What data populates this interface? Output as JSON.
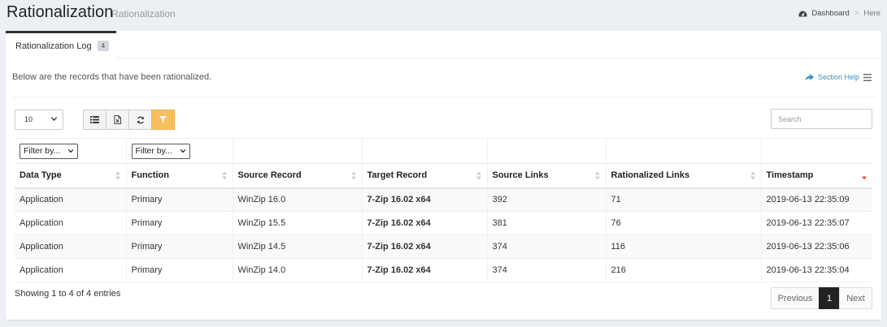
{
  "header": {
    "title": "Rationalization",
    "subtitle": "Rationalization",
    "breadcrumb": {
      "dashboard": "Dashboard",
      "separator": ">",
      "current": "Here"
    }
  },
  "tab": {
    "label": "Rationalization Log",
    "badge": "4"
  },
  "intro_text": "Below are the records that have been rationalized.",
  "section_help": "Section Help",
  "toolbar": {
    "page_length": "10",
    "search_placeholder": "Search",
    "buttons": [
      "list-icon",
      "excel-export-icon",
      "refresh-icon",
      "filter-icon"
    ],
    "active_button_color": "#f6bf5e"
  },
  "filters": {
    "data_type": "Filter by...",
    "function": "Filter by..."
  },
  "table": {
    "columns": [
      "Data Type",
      "Function",
      "Source Record",
      "Target Record",
      "Source Links",
      "Rationalized Links",
      "Timestamp"
    ],
    "sorted_column": "Timestamp",
    "sort_direction": "desc",
    "rows": [
      [
        "Application",
        "Primary",
        "WinZip 16.0",
        "7-Zip 16.02 x64",
        "392",
        "71",
        "2019-06-13 22:35:09"
      ],
      [
        "Application",
        "Primary",
        "WinZip 15.5",
        "7-Zip 16.02 x64",
        "381",
        "76",
        "2019-06-13 22:35:07"
      ],
      [
        "Application",
        "Primary",
        "WinZip 14.5",
        "7-Zip 16.02 x64",
        "374",
        "116",
        "2019-06-13 22:35:06"
      ],
      [
        "Application",
        "Primary",
        "WinZip 14.0",
        "7-Zip 16.02 x64",
        "374",
        "216",
        "2019-06-13 22:35:04"
      ]
    ]
  },
  "footer": {
    "info": "Showing 1 to 4 of 4 entries",
    "pagination": {
      "previous": "Previous",
      "current": "1",
      "next": "Next"
    }
  }
}
